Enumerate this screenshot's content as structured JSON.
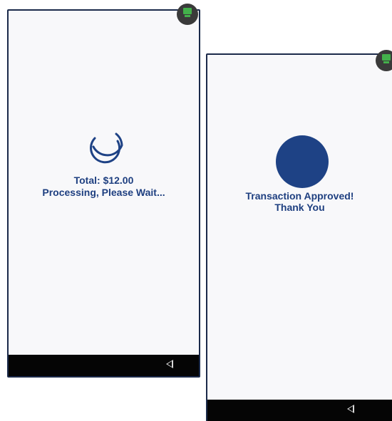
{
  "processing_screen": {
    "total": "Total: $12.00",
    "message": "Processing, Please Wait...",
    "spinner_icon": "loading-spinner-icon",
    "nav_icon": "back-triangle-icon"
  },
  "approved_screen": {
    "line1": "Transaction Approved!",
    "line2": "Thank You",
    "status_icon": "approved-circle-icon",
    "nav_icon": "back-triangle-icon"
  },
  "colors": {
    "accent": "#1e4285",
    "text": "#1e3f80",
    "screen_bg": "#f8f8fa",
    "nav_bar": "#050505",
    "badge_bg": "#3a3a3a",
    "badge_icon": "#43b14b"
  }
}
